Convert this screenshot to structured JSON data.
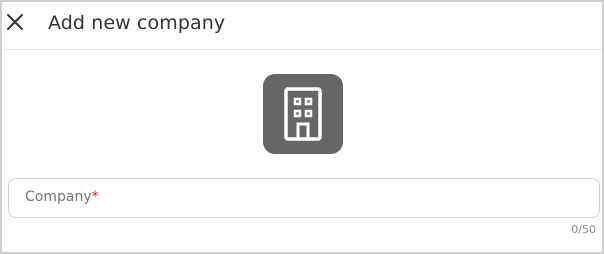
{
  "dialog": {
    "title": "Add new company",
    "close_icon": "close-icon",
    "avatar_icon": "building-icon",
    "avatar_color": "#666666"
  },
  "company_field": {
    "label": "Company",
    "required_mark": "*",
    "value": "",
    "counter": "0/50"
  }
}
